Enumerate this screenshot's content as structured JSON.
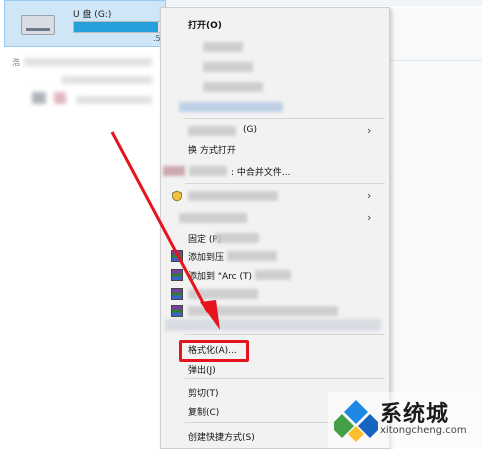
{
  "drive": {
    "name": "U 盘 (G:)",
    "free_text": ".5",
    "usage_fraction": 0.95
  },
  "left_nav": {
    "item_text": "浩"
  },
  "context_menu": {
    "open_label": "打开(O)",
    "group_suffix_label": "(G)",
    "open_with_label": "换    方式打开",
    "merge_label": ":  中合并文件...",
    "pin_label": "固定    (P)",
    "add_to_archive_label": "添加到压",
    "add_to_named_archive_label": "添加到 \"Arc          (T)",
    "format_label": "格式化(A)...",
    "eject_label": "弹出(J)",
    "cut_label": "剪切(T)",
    "copy_label": "复制(C)",
    "create_shortcut_label": "创建快捷方式(S)"
  },
  "annotation": {
    "highlight_color": "#e5141e"
  },
  "watermark": {
    "brand": "系统城",
    "url": "xitongcheng.com"
  }
}
